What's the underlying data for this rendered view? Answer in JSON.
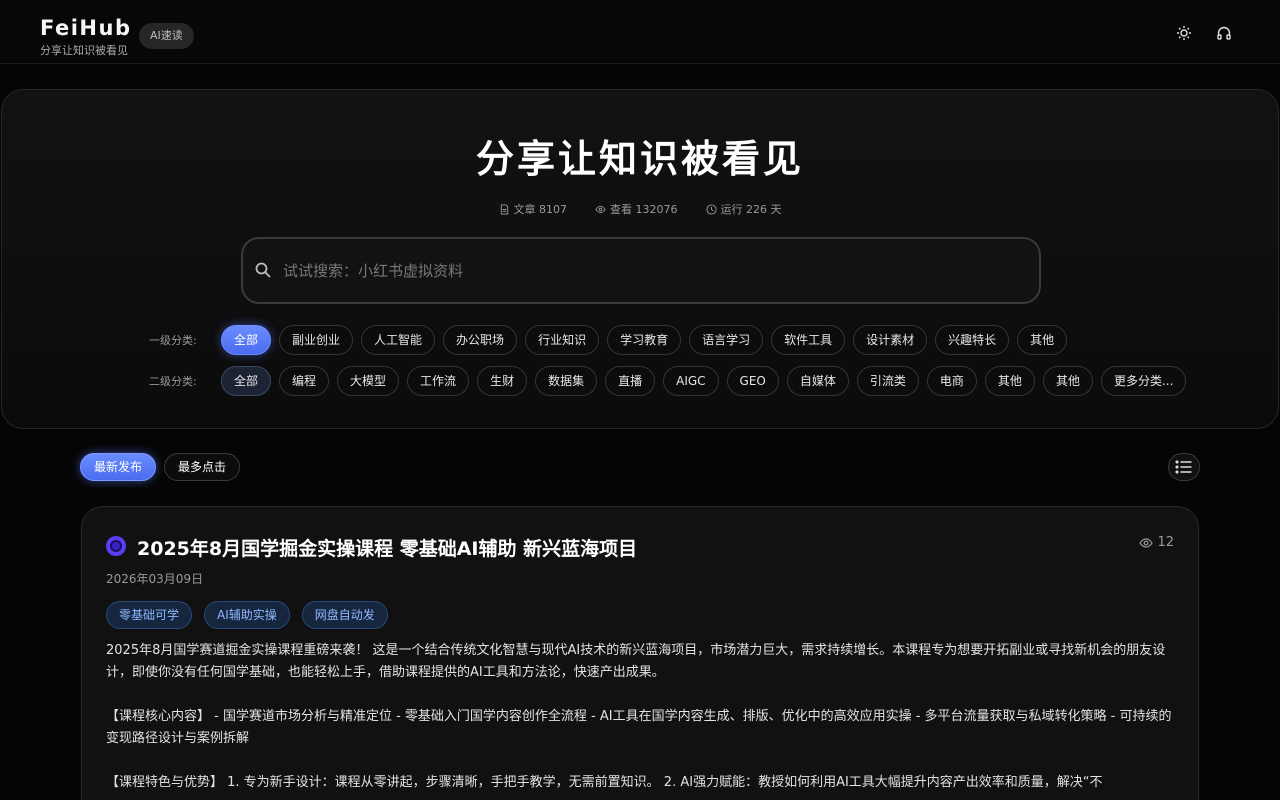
{
  "header": {
    "brand": "FeiHub",
    "tagline": "分享让知识被看见",
    "badge": "AI速读",
    "theme_icon": "sun-icon",
    "support_icon": "headphones-icon"
  },
  "hero": {
    "title": "分享让知识被看见",
    "stats": [
      {
        "icon": "document-icon",
        "text": "文章 8107"
      },
      {
        "icon": "eye-icon",
        "text": "查看 132076"
      },
      {
        "icon": "clock-icon",
        "text": "运行 226 天"
      }
    ],
    "search_placeholder": "试试搜索：小红书虚拟资料"
  },
  "categories": {
    "level1_label": "一级分类:",
    "level1": [
      "全部",
      "副业创业",
      "人工智能",
      "办公职场",
      "行业知识",
      "学习教育",
      "语言学习",
      "软件工具",
      "设计素材",
      "兴趣特长",
      "其他"
    ],
    "level2_label": "二级分类:",
    "level2": [
      "全部",
      "编程",
      "大模型",
      "工作流",
      "生财",
      "数据集",
      "直播",
      "AIGC",
      "GEO",
      "自媒体",
      "引流类",
      "电商",
      "其他",
      "其他",
      "更多分类..."
    ]
  },
  "sort_tabs": [
    "最新发布",
    "最多点击"
  ],
  "article": {
    "title": "2025年8月国学掘金实操课程 零基础AI辅助 新兴蓝海项目",
    "views": "12",
    "date": "2026年03月09日",
    "tags": [
      "零基础可学",
      "AI辅助实操",
      "网盘自动发"
    ],
    "paragraphs": [
      "2025年8月国学赛道掘金实操课程重磅来袭！  这是一个结合传统文化智慧与现代AI技术的新兴蓝海项目，市场潜力巨大，需求持续增长。本课程专为想要开拓副业或寻找新机会的朋友设计，即使你没有任何国学基础，也能轻松上手，借助课程提供的AI工具和方法论，快速产出成果。",
      "【课程核心内容】 - 国学赛道市场分析与精准定位 - 零基础入门国学内容创作全流程 - AI工具在国学内容生成、排版、优化中的高效应用实操 - 多平台流量获取与私域转化策略 - 可持续的变现路径设计与案例拆解",
      "【课程特色与优势】 1. 专为新手设计：课程从零讲起，步骤清晰，手把手教学，无需前置知识。 2. AI强力赋能：教授如何利用AI工具大幅提升内容产出效率和质量，解决“不"
    ]
  }
}
